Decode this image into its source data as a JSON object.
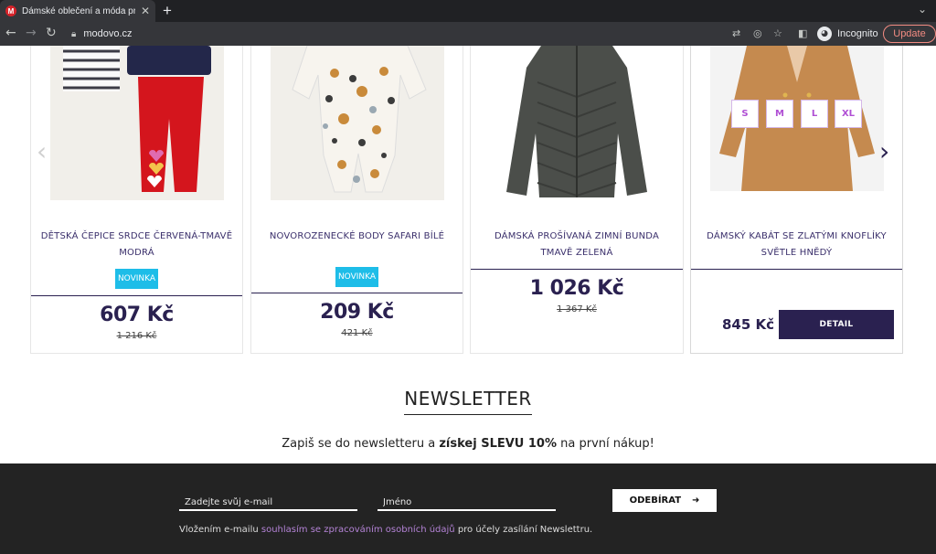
{
  "browser": {
    "tab_title": "Dámské oblečení a móda pro ž",
    "favicon_letter": "M",
    "url": "modovo.cz",
    "profile_label": "Incognito",
    "update_label": "Update"
  },
  "products": [
    {
      "name": "DĚTSKÁ ČEPICE SRDCE ČERVENÁ-TMAVĚ MODRÁ",
      "badge": "NOVINKA",
      "price": "607 Kč",
      "old_price": "1 216 Kč"
    },
    {
      "name": "NOVOROZENECKÉ BODY SAFARI BÍLÉ",
      "badge": "NOVINKA",
      "price": "209 Kč",
      "old_price": "421 Kč"
    },
    {
      "name": "DÁMSKÁ PROŠÍVANÁ ZIMNÍ BUNDA TMAVĚ ZELENÁ",
      "price": "1 026 Kč",
      "old_price": "1 367 Kč"
    },
    {
      "name": "DÁMSKÝ KABÁT SE ZLATÝMI KNOFLÍKY SVĚTLE HNĚDÝ",
      "sizes": [
        "S",
        "M",
        "L",
        "XL"
      ],
      "price": "845 Kč",
      "detail_label": "DETAIL"
    }
  ],
  "newsletter": {
    "title": "NEWSLETTER",
    "text_before": "Zapiš se do newsletteru a ",
    "text_bold": "získej SLEVU 10%",
    "text_after": " na první nákup!",
    "email_placeholder": "Zadejte svůj e-mail",
    "name_placeholder": "Jméno",
    "subscribe_label": "ODEBÍRAT",
    "subscribe_arrow": "➜",
    "consent_before": "Vložením e-mailu ",
    "consent_link": "souhlasím se zpracováním osobních údajů",
    "consent_after": " pro účely zasílání Newslettru."
  },
  "colors": {
    "brand_navy": "#2a2150",
    "badge_blue": "#1ebde8",
    "size_purple": "#b04fd4",
    "footer_bg": "#232323"
  }
}
